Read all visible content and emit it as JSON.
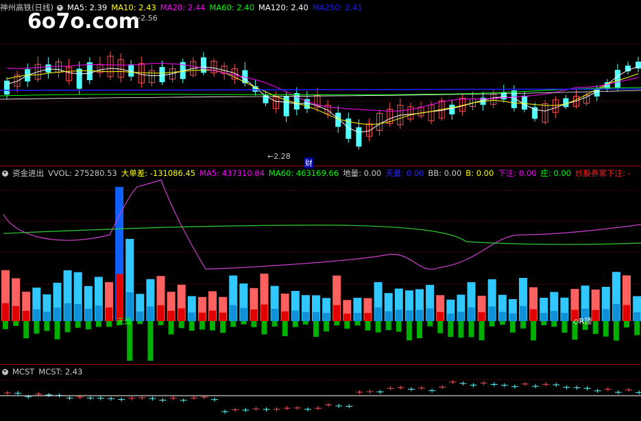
{
  "watermark": "6o7o.com",
  "main": {
    "stock_name": "神州高铁(日线)",
    "ma5": "MA5: 2.39",
    "ma10": "MA10: 2.43",
    "ma20": "MA20: 2.44",
    "ma60": "MA60: 2.40",
    "ma120": "MA120: 2.40",
    "ma250": "MA250: 2.41",
    "high_label": "2.56",
    "low_label": "2.28",
    "cai_label": "财",
    "colors": {
      "ma5": "#ffffff",
      "ma10": "#ffff00",
      "ma20": "#ff00ff",
      "ma60": "#00ff00",
      "ma120": "#ffffff",
      "ma250": "#0000ff",
      "up": "#ff5050",
      "down": "#54ffff"
    }
  },
  "fund": {
    "name": "资金进出",
    "vol": "VVOL: 275280.53",
    "dadan": "大单差: -131086.45",
    "ma5": "MA5: 437310.84",
    "ma60": "MA60: 463169.66",
    "dili": "地量: 0.00",
    "tianliang": "天量: 0.00",
    "bb": "BB: 0.00",
    "b": "B: 0.00",
    "xiazhu": "下注: 0.00",
    "zhuang": "庄: 0.00",
    "chaogu": "炒股养家下注: -",
    "signal_left": "天量",
    "signal_right": "◇R顶"
  },
  "mcst": {
    "name": "MCST",
    "value": "MCST: 2.43"
  },
  "chart_data": {
    "type": "candlestick",
    "title": "神州高铁(日线)",
    "y_axis_visible": false,
    "price_annotations": {
      "high": 2.56,
      "low": 2.28
    }
  }
}
